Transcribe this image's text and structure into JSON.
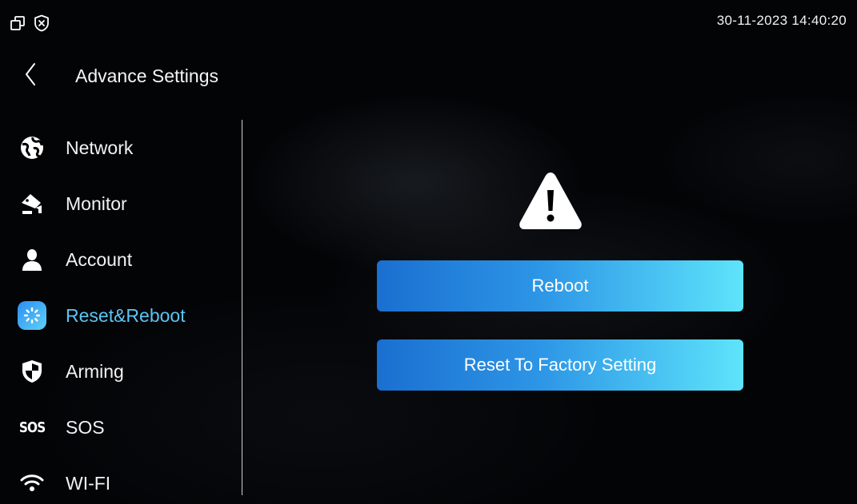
{
  "status_bar": {
    "datetime": "30-11-2023 14:40:20",
    "icons": [
      "window-restore-icon",
      "shield-x-icon"
    ]
  },
  "header": {
    "title": "Advance Settings",
    "back_icon": "chevron-left-icon"
  },
  "sidebar": {
    "items": [
      {
        "label": "Network",
        "icon": "globe-icon",
        "active": false
      },
      {
        "label": "Monitor",
        "icon": "camera-icon",
        "active": false
      },
      {
        "label": "Account",
        "icon": "user-icon",
        "active": false
      },
      {
        "label": "Reset&Reboot",
        "icon": "reset-spinner-icon",
        "active": true
      },
      {
        "label": "Arming",
        "icon": "shield-icon",
        "active": false
      },
      {
        "label": "SOS",
        "icon": "sos-icon",
        "icon_text": "SOS",
        "active": false
      },
      {
        "label": "WI-FI",
        "icon": "wifi-icon",
        "active": false
      }
    ]
  },
  "main": {
    "warning_icon": "warning-triangle-icon",
    "reboot_label": "Reboot",
    "reset_label": "Reset To Factory Setting"
  },
  "colors": {
    "accent": "#5cc4f5",
    "button_gradient_start": "#1a6fd0",
    "button_gradient_end": "#5ee4fb",
    "background": "#030406"
  }
}
